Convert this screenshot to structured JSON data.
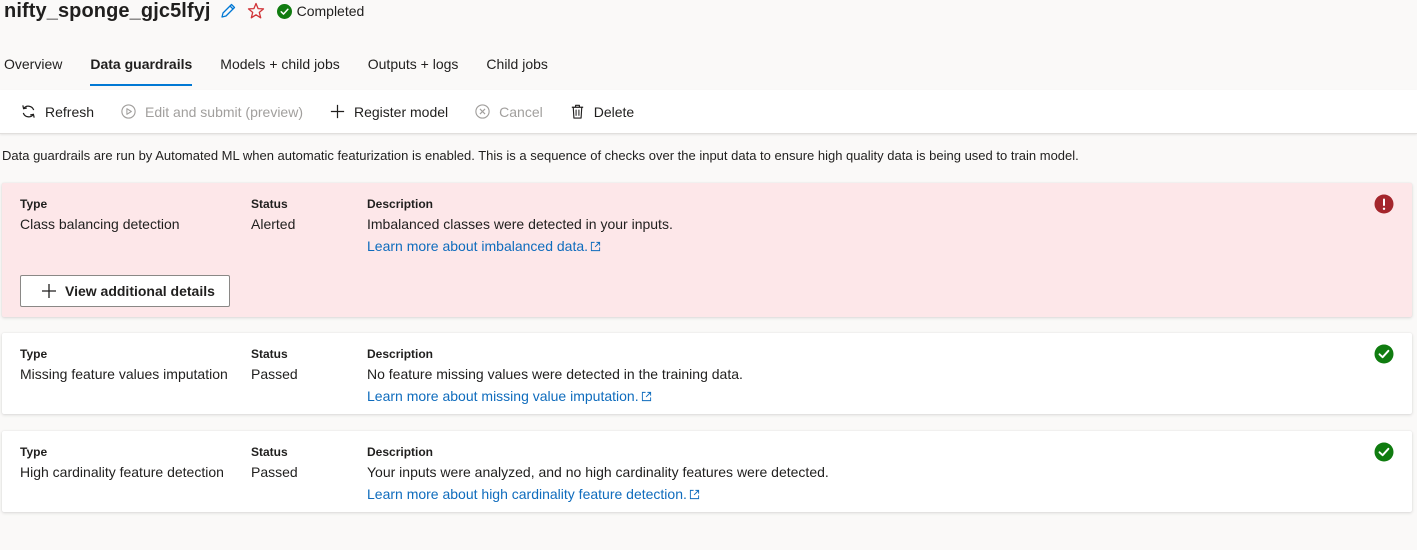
{
  "header": {
    "job_name": "nifty_sponge_gjc5lfyj",
    "status": "Completed"
  },
  "tabs": [
    {
      "label": "Overview"
    },
    {
      "label": "Data guardrails",
      "active": true
    },
    {
      "label": "Models + child jobs"
    },
    {
      "label": "Outputs + logs"
    },
    {
      "label": "Child jobs"
    }
  ],
  "toolbar": {
    "refresh": "Refresh",
    "edit_submit": "Edit and submit (preview)",
    "register_model": "Register model",
    "cancel": "Cancel",
    "delete": "Delete"
  },
  "intro": "Data guardrails are run by Automated ML when automatic featurization is enabled. This is a sequence of checks over the input data to ensure high quality data is being used to train model.",
  "labels": {
    "type": "Type",
    "status": "Status",
    "description": "Description"
  },
  "guardrails": [
    {
      "type": "Class balancing detection",
      "status": "Alerted",
      "description": "Imbalanced classes were detected in your inputs.",
      "link": "Learn more about imbalanced data.",
      "button": "View additional details"
    },
    {
      "type": "Missing feature values imputation",
      "status": "Passed",
      "description": "No feature missing values were detected in the training data.",
      "link": "Learn more about missing value imputation."
    },
    {
      "type": "High cardinality feature detection",
      "status": "Passed",
      "description": "Your inputs were analyzed, and no high cardinality features were detected.",
      "link": "Learn more about high cardinality feature detection."
    }
  ],
  "icons": {
    "pencil": "pencil-icon",
    "star": "star-icon",
    "status_ok": "check-circle-icon",
    "alert": "error-icon",
    "external": "external-link-icon"
  },
  "colors": {
    "accent": "#0078d4",
    "link": "#0f6cbd",
    "success": "#107c10",
    "error": "#a4262c",
    "alert_bg": "#fde7e9",
    "star": "#d13438",
    "disabled": "#a19f9d"
  }
}
